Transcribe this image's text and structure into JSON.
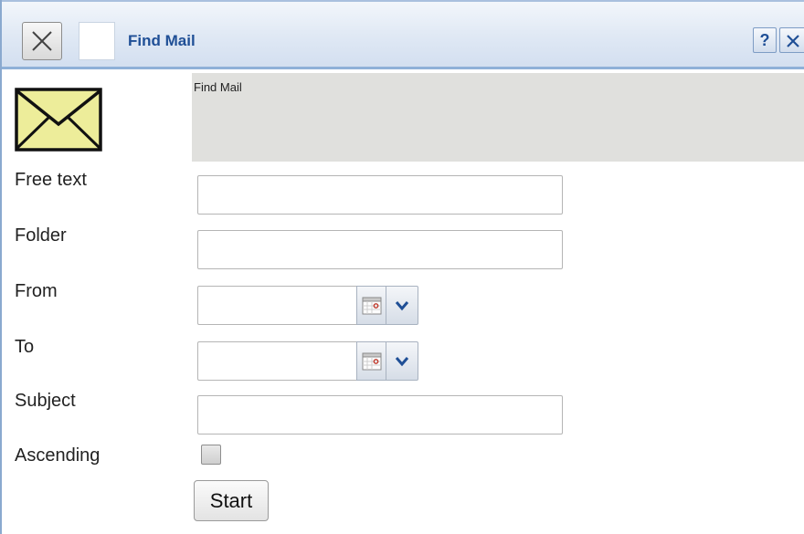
{
  "window": {
    "title": "Find Mail",
    "help_label": "?"
  },
  "header": {
    "text": "Find Mail"
  },
  "form": {
    "free_text_label": "Free text",
    "free_text_value": "",
    "folder_label": "Folder",
    "folder_value": "",
    "from_label": "From",
    "from_value": "",
    "to_label": "To",
    "to_value": "",
    "subject_label": "Subject",
    "subject_value": "",
    "ascending_label": "Ascending",
    "ascending_checked": false,
    "start_label": "Start"
  },
  "colors": {
    "title_text": "#1f4f96",
    "titlebar": "#dfe8f4",
    "header_panel": "#e0e0dd",
    "mail_icon_fill": "#eded9a"
  },
  "icons": {
    "titlebar_close": "close-icon",
    "help": "help-icon",
    "window_close": "close-icon",
    "mail": "envelope-icon",
    "calendar": "calendar-icon",
    "dropdown": "chevron-down-icon"
  }
}
